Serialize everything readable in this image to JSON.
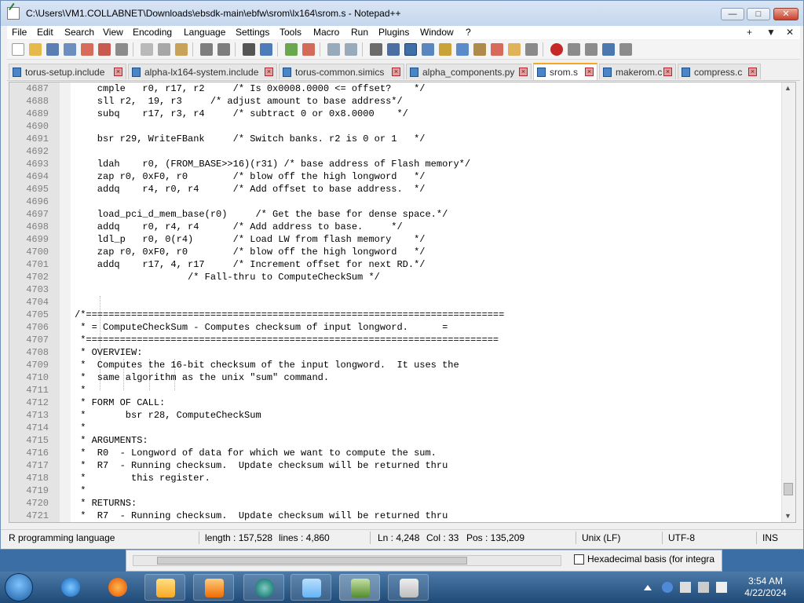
{
  "window": {
    "title": "C:\\Users\\VM1.COLLABNET\\Downloads\\ebsdk-main\\ebfw\\srom\\lx164\\srom.s - Notepad++",
    "minimize": "—",
    "maximize": "□",
    "close": "✕"
  },
  "menu": {
    "items": [
      "File",
      "Edit",
      "Search",
      "View",
      "Encoding",
      "Language",
      "Settings",
      "Tools",
      "Macro",
      "Run",
      "Plugins",
      "Window",
      "?"
    ],
    "right": [
      "+",
      "▼",
      "✕"
    ]
  },
  "tabs": [
    {
      "label": "torus-setup.include",
      "active": false
    },
    {
      "label": "alpha-lx164-system.include",
      "active": false
    },
    {
      "label": "torus-common.simics",
      "active": false
    },
    {
      "label": "alpha_components.py",
      "active": false
    },
    {
      "label": "srom.s",
      "active": true
    },
    {
      "label": "makerom.c",
      "active": false
    },
    {
      "label": "compress.c",
      "active": false
    }
  ],
  "editor": {
    "lines": [
      {
        "n": "4687",
        "t": "    cmple   r0, r17, r2     /* Is 0x0008.0000 <= offset?    */"
      },
      {
        "n": "4688",
        "t": "    sll r2,  19, r3     /* adjust amount to base address*/"
      },
      {
        "n": "4689",
        "t": "    subq    r17, r3, r4     /* subtract 0 or 0x8.0000    */"
      },
      {
        "n": "4690",
        "t": ""
      },
      {
        "n": "4691",
        "t": "    bsr r29, WriteFBank     /* Switch banks. r2 is 0 or 1   */"
      },
      {
        "n": "4692",
        "t": ""
      },
      {
        "n": "4693",
        "t": "    ldah    r0, (FROM_BASE>>16)(r31) /* base address of Flash memory*/"
      },
      {
        "n": "4694",
        "t": "    zap r0, 0xF0, r0        /* blow off the high longword   */"
      },
      {
        "n": "4695",
        "t": "    addq    r4, r0, r4      /* Add offset to base address.  */"
      },
      {
        "n": "4696",
        "t": ""
      },
      {
        "n": "4697",
        "t": "    load_pci_d_mem_base(r0)     /* Get the base for dense space.*/"
      },
      {
        "n": "4698",
        "t": "    addq    r0, r4, r4      /* Add address to base.     */"
      },
      {
        "n": "4699",
        "t": "    ldl_p   r0, 0(r4)       /* Load LW from flash memory    */"
      },
      {
        "n": "4700",
        "t": "    zap r0, 0xF0, r0        /* blow off the high longword   */"
      },
      {
        "n": "4701",
        "t": "    addq    r17, 4, r17     /* Increment offset for next RD.*/"
      },
      {
        "n": "4702",
        "t": "                    /* Fall-thru to ComputeCheckSum */"
      },
      {
        "n": "4703",
        "t": ""
      },
      {
        "n": "4704",
        "t": ""
      },
      {
        "n": "4705",
        "t": "/*=========================================================================="
      },
      {
        "n": "4706",
        "t": " * = ComputeCheckSum - Computes checksum of input longword.      ="
      },
      {
        "n": "4707",
        "t": " *========================================================================="
      },
      {
        "n": "4708",
        "t": " * OVERVIEW:"
      },
      {
        "n": "4709",
        "t": " *  Computes the 16-bit checksum of the input longword.  It uses the"
      },
      {
        "n": "4710",
        "t": " *  same algorithm as the unix \"sum\" command."
      },
      {
        "n": "4711",
        "t": " *"
      },
      {
        "n": "4712",
        "t": " * FORM OF CALL:"
      },
      {
        "n": "4713",
        "t": " *       bsr r28, ComputeCheckSum"
      },
      {
        "n": "4714",
        "t": " *"
      },
      {
        "n": "4715",
        "t": " * ARGUMENTS:"
      },
      {
        "n": "4716",
        "t": " *  R0  - Longword of data for which we want to compute the sum."
      },
      {
        "n": "4717",
        "t": " *  R7  - Running checksum.  Update checksum will be returned thru"
      },
      {
        "n": "4718",
        "t": " *        this register."
      },
      {
        "n": "4719",
        "t": " *"
      },
      {
        "n": "4720",
        "t": " * RETURNS:"
      },
      {
        "n": "4721",
        "t": " *  R7  - Running checksum.  Update checksum will be returned thru"
      }
    ]
  },
  "status": {
    "language": "R programming language",
    "length": "length : 157,528",
    "lines": "lines : 4,860",
    "ln": "Ln : 4,248",
    "col": "Col : 33",
    "pos": "Pos : 135,209",
    "eol": "Unix (LF)",
    "encoding": "UTF-8",
    "mode": "INS"
  },
  "background_window": {
    "checkbox_label": "Hexadecimal basis (for integra"
  },
  "taskbar": {
    "apps": [
      "internet-explorer",
      "firefox",
      "file-explorer",
      "media-player",
      "app-sphere",
      "app-curve",
      "notepad-plus-plus",
      "hxd"
    ],
    "time": "3:54 AM",
    "date": "4/22/2024"
  },
  "colors": {
    "accent_tab": "#f5a623",
    "taskbar": "#2a5585"
  }
}
